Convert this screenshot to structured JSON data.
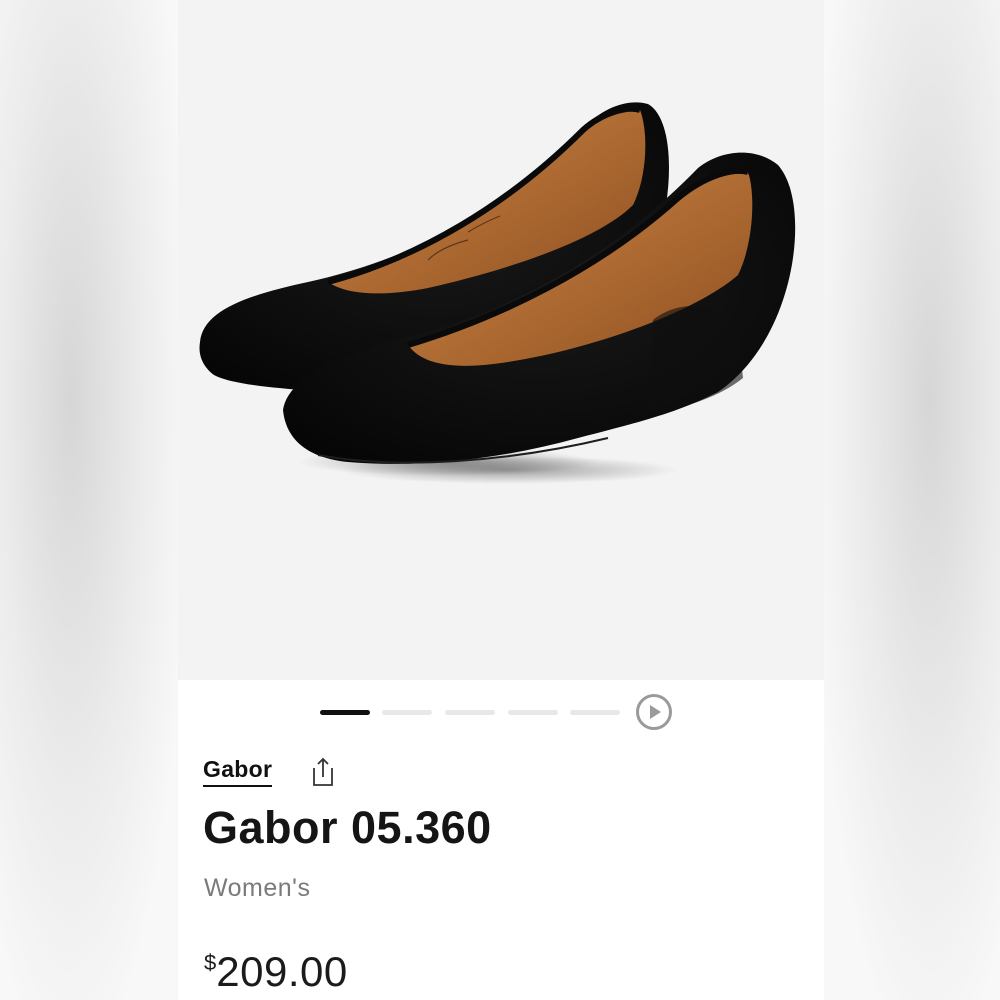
{
  "product": {
    "brand": "Gabor",
    "title": "Gabor 05.360",
    "gender": "Women's",
    "price": {
      "currency_symbol": "$",
      "amount": "209.00"
    }
  },
  "gallery": {
    "image_count": 5,
    "active_index": 0,
    "play_icon": "play-circle-icon",
    "share_icon": "share-icon"
  },
  "colors": {
    "shoe_suede": "#0d0d0d",
    "lining": "#b8743a",
    "pager_active": "#111111",
    "pager_inactive": "#e8e8e8",
    "gender_text": "#7a7a7a"
  }
}
